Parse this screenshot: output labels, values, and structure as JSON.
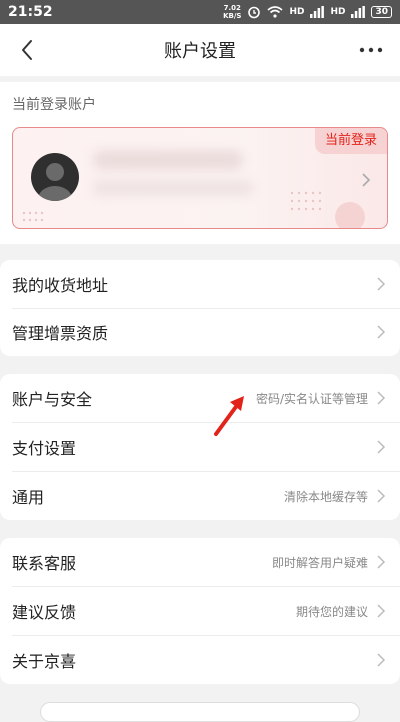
{
  "status_bar": {
    "time": "21:52",
    "net_speed_value": "7.02",
    "net_speed_unit": "KB/S",
    "signal_1": "HD",
    "signal_2": "HD",
    "battery": "30"
  },
  "nav": {
    "title": "账户设置"
  },
  "account": {
    "section_label": "当前登录账户",
    "current_badge": "当前登录"
  },
  "groups": [
    {
      "rows": [
        {
          "label": "我的收货地址",
          "hint": ""
        },
        {
          "label": "管理增票资质",
          "hint": ""
        }
      ]
    },
    {
      "rows": [
        {
          "label": "账户与安全",
          "hint": "密码/实名认证等管理"
        },
        {
          "label": "支付设置",
          "hint": ""
        },
        {
          "label": "通用",
          "hint": "清除本地缓存等"
        }
      ]
    },
    {
      "rows": [
        {
          "label": "联系客服",
          "hint": "即时解答用户疑难"
        },
        {
          "label": "建议反馈",
          "hint": "期待您的建议"
        },
        {
          "label": "关于京喜",
          "hint": ""
        }
      ]
    }
  ],
  "colors": {
    "accent_red": "#e2231a",
    "card_border": "#e88a8a",
    "background": "#f2f2f2"
  }
}
